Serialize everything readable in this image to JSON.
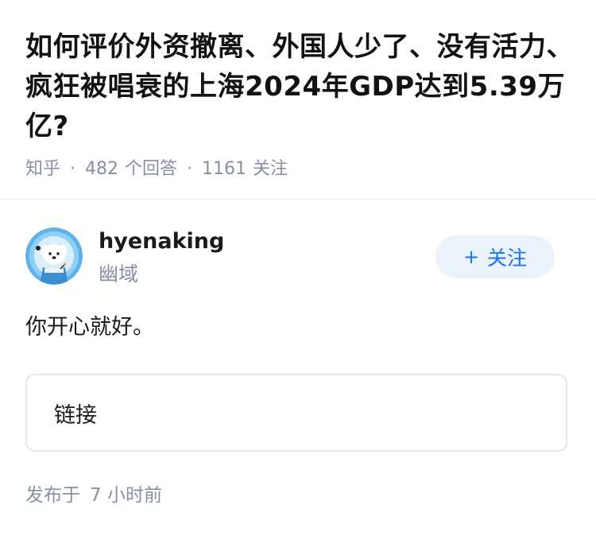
{
  "question": {
    "title": "如何评价外资撤离、外国人少了、没有活力、疯狂被唱衰的上海2024年GDP达到5.39万亿?",
    "source": "知乎",
    "answer_count": "482",
    "answer_label": "个回答",
    "follower_count": "1161",
    "follower_label": "关注",
    "separator": "·"
  },
  "author": {
    "name": "hyenaking",
    "subtitle": "幽域",
    "avatar_icon": "cartoon-dog-avatar"
  },
  "follow_button": {
    "plus": "+",
    "label": "关注"
  },
  "answer": {
    "text": "你开心就好。",
    "link_label": "链接",
    "publish_prefix": "发布于",
    "publish_time": "7 小时前"
  },
  "colors": {
    "accent": "#1772f6",
    "follow_bg": "#eaf2fc",
    "meta": "#8590a6",
    "avatar_bg": "#5fb2ea"
  }
}
